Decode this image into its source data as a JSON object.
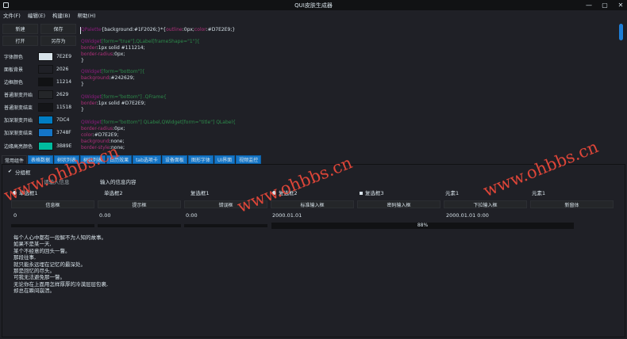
{
  "window": {
    "title": "QUI皮肤生成器",
    "minimize": "—",
    "maximize": "▢",
    "close": "✕"
  },
  "menu": [
    "文件(F)",
    "编辑(E)",
    "构建(B)",
    "帮助(H)"
  ],
  "left": {
    "buttons": {
      "new": "新建",
      "save": "保存",
      "open": "打开",
      "save_as": "另存为"
    },
    "colors": [
      {
        "label": "字体颜色",
        "value": "7E2E9",
        "color": "#D7E2E9"
      },
      {
        "label": "面板背景",
        "value": "2026",
        "color": "#1F2026"
      },
      {
        "label": "边框颜色",
        "value": "11214",
        "color": "#111214"
      },
      {
        "label": "普通渐变开始",
        "value": "2629",
        "color": "#242629"
      },
      {
        "label": "普通渐变结束",
        "value": "11518",
        "color": "#141518"
      },
      {
        "label": "加深渐变开始",
        "value": "7DC4",
        "color": "#007DC4"
      },
      {
        "label": "加深渐变结束",
        "value": "3748F",
        "color": "#1475C7"
      },
      {
        "label": "边缘高亮颜色",
        "value": "3B89E",
        "color": "#00BB9E"
      }
    ]
  },
  "code": {
    "l1a": "QPalette",
    "l1b": "{background:",
    "l1c": "#1F2026;}*{",
    "l1d": "outline",
    "l1e": ":0px;",
    "l1f": "color",
    "l1g": ":#D7E2E9;}",
    "l2a": "QWidget",
    "l2b": "[form=\"true\"],QLabel[frameShape=\"1\"]{",
    "l3a": "border",
    "l3b": ":1px solid #111214;",
    "l4a": "border-radius",
    "l4b": ":0px;",
    "l5": "}",
    "l6a": "QWidget",
    "l6b": "[form=\"bottom\"]{",
    "l7a": "background",
    "l7b": ":#242629;",
    "l8": "}",
    "l9a": "QWidget",
    "l9b": "[form=\"bottom\"] .QFrame{",
    "l10a": "border",
    "l10b": ":1px solid #D7E2E9;",
    "l11": "}",
    "l12a": "QWidget",
    "l12b": "[form=\"bottom\"] QLabel,QWidget[form=\"title\"] QLabel{",
    "l13a": "border-radius",
    "l13b": ":0px;",
    "l14a": "color",
    "l14b": ":#D7E2E9;",
    "l15a": "background",
    "l15b": ":none;",
    "l16a": "border-style",
    "l16b": ":none;"
  },
  "tabs": [
    "常用组件",
    "表格数据",
    "树状列表",
    "树状列表",
    "日历效果",
    "tab选项卡",
    "设备面板",
    "图形字体",
    "UI界面",
    "视频监控"
  ],
  "content": {
    "groupbox": "分组框",
    "input_hint": "请输入信息",
    "input_content": "输入的信息内容",
    "radios": [
      "单选框1",
      "单选框2"
    ],
    "checks": [
      "复选框1",
      "复选框2",
      "复选框3"
    ],
    "combo1": "元素1",
    "combo2": "元素1",
    "buttons": [
      "信息框",
      "提示框",
      "错误框",
      "标准输入框",
      "密码输入框",
      "下拉输入框",
      "新窗体"
    ],
    "fields": [
      "0",
      "0.00",
      "0:00",
      "2000.01.01",
      "2000.01.01 0:00"
    ],
    "progress": "88%",
    "progress_value": 88,
    "poem": [
      "每个人心中都有一段解不为人知的故事。",
      "如果不是某一天,",
      "某个不经意的回头一瞥。",
      "那段往事,",
      "就只能永远埋在记忆的最深处。",
      "那是回忆的尽头。",
      "可我无法避免那一瞥。",
      "无论你在上面用怎样厚厚的冷漠层层包裹,",
      "却总在瞬间崩溃。"
    ]
  },
  "watermark": "www.ohbbs.cn"
}
